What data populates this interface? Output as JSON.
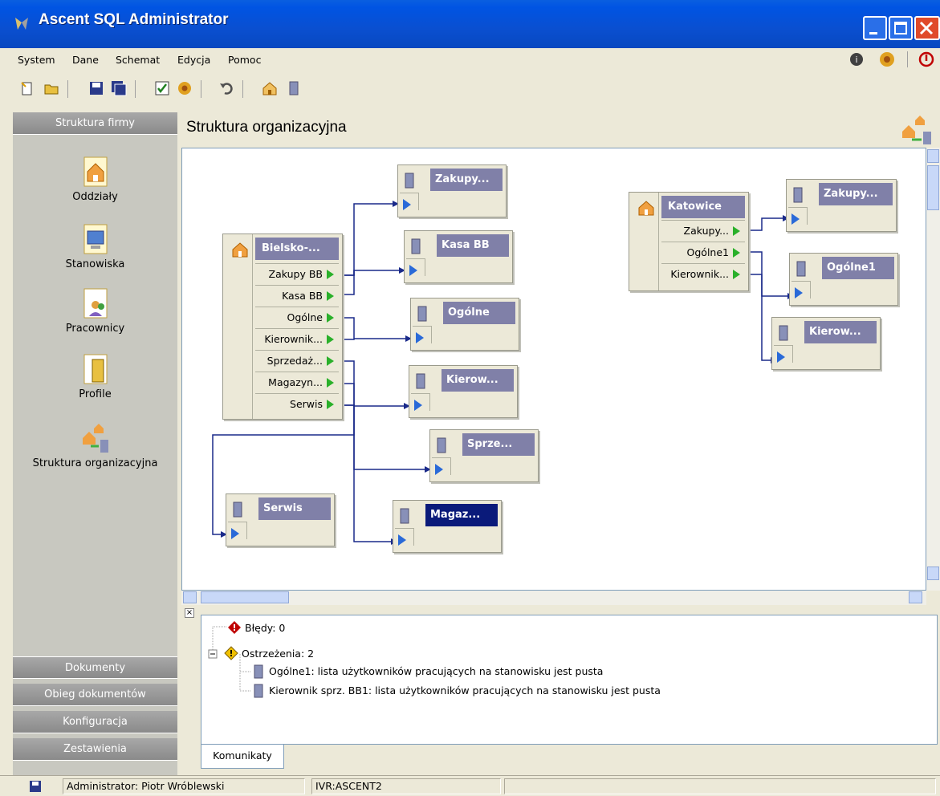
{
  "window": {
    "title": "Ascent SQL Administrator"
  },
  "menu": [
    "System",
    "Dane",
    "Schemat",
    "Edycja",
    "Pomoc"
  ],
  "sidebar": {
    "header": "Struktura firmy",
    "items": [
      "Oddziały",
      "Stanowiska",
      "Pracownicy",
      "Profile",
      "Struktura organizacyjna"
    ],
    "bottom_sections": [
      "Dokumenty",
      "Obieg dokumentów",
      "Konfiguracja",
      "Zestawienia"
    ]
  },
  "main": {
    "title": "Struktura organizacyjna",
    "parent1": {
      "title": "Bielsko-...",
      "rows": [
        "Zakupy BB",
        "Kasa BB",
        "Ogólne",
        "Kierownik...",
        "Sprzedaż...",
        "Magazyn...",
        "Serwis"
      ]
    },
    "parent2": {
      "title": "Katowice",
      "rows": [
        "Zakupy...",
        "Ogólne1",
        "Kierownik..."
      ]
    },
    "children1": [
      "Zakupy...",
      "Kasa BB",
      "Ogólne",
      "Kierow...",
      "Sprze...",
      "Serwis",
      "Magaz..."
    ],
    "children2": [
      "Zakupy...",
      "Ogólne1",
      "Kierow..."
    ]
  },
  "messages": {
    "errors": "Błędy: 0",
    "warnings": "Ostrzeżenia: 2",
    "items": [
      "Ogólne1: lista użytkowników pracujących na stanowisku jest pusta",
      "Kierownik sprz. BB1: lista użytkowników pracujących na stanowisku jest pusta"
    ],
    "tab": "Komunikaty"
  },
  "status": {
    "user": "Administrator: Piotr Wróblewski",
    "server": "IVR:ASCENT2"
  }
}
